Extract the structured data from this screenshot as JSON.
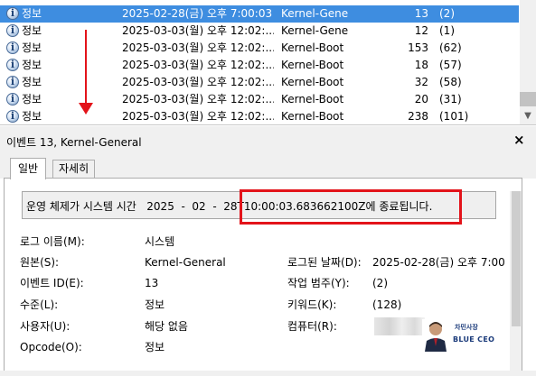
{
  "event_list": {
    "rows": [
      {
        "level": "정보",
        "date": "2025-02-28(금) 오후 7:00:03",
        "source": "Kernel-Gener",
        "event_id": "13",
        "category": "(2)",
        "selected": true
      },
      {
        "level": "정보",
        "date": "2025-03-03(월) 오후 12:02:...",
        "source": "Kernel-Gene...",
        "event_id": "12",
        "category": "(1)",
        "selected": false
      },
      {
        "level": "정보",
        "date": "2025-03-03(월) 오후 12:02:...",
        "source": "Kernel-Boot",
        "event_id": "153",
        "category": "(62)",
        "selected": false
      },
      {
        "level": "정보",
        "date": "2025-03-03(월) 오후 12:02:...",
        "source": "Kernel-Boot",
        "event_id": "18",
        "category": "(57)",
        "selected": false
      },
      {
        "level": "정보",
        "date": "2025-03-03(월) 오후 12:02:...",
        "source": "Kernel-Boot",
        "event_id": "32",
        "category": "(58)",
        "selected": false
      },
      {
        "level": "정보",
        "date": "2025-03-03(월) 오후 12:02:...",
        "source": "Kernel-Boot",
        "event_id": "20",
        "category": "(31)",
        "selected": false
      },
      {
        "level": "정보",
        "date": "2025-03-03(월) 오후 12:02:...",
        "source": "Kernel-Boot",
        "event_id": "238",
        "category": "(101)",
        "selected": false
      }
    ],
    "scroll_down_glyph": "▼",
    "icon": "info-icon"
  },
  "detail": {
    "title": "이벤트 13, Kernel-General",
    "close_glyph": "×",
    "tabs": {
      "general": "일반",
      "details": "자세히"
    },
    "description": "운영 체제가 시스템 시간   2025  -  02  -  28T10:00:03.683662100Z에 종료됩니다.",
    "fields": {
      "log_name_label": "로그 이름(M):",
      "log_name_value": "시스템",
      "source_label": "원본(S):",
      "source_value": "Kernel-General",
      "logged_label": "로그된 날짜(D):",
      "logged_value": "2025-02-28(금) 오후 7:00",
      "event_id_label": "이벤트 ID(E):",
      "event_id_value": "13",
      "task_label": "작업 범주(Y):",
      "task_value": "(2)",
      "level_label": "수준(L):",
      "level_value": "정보",
      "keywords_label": "키워드(K):",
      "keywords_value": "(128)",
      "user_label": "사용자(U):",
      "user_value": "해당 없음",
      "computer_label": "컴퓨터(R):",
      "opcode_label": "Opcode(O):",
      "opcode_value": "정보"
    }
  },
  "watermark": {
    "top_text": "차민사장",
    "bottom_text": "BLUE CEO"
  },
  "colors": {
    "selection": "#3e8de0",
    "annotation": "#e3131a",
    "panel": "#f0f0f0"
  }
}
